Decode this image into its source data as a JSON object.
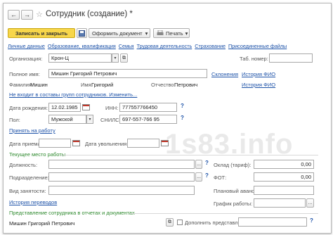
{
  "header": {
    "title": "Сотрудник (создание) *",
    "back_arrow": "←",
    "forward_arrow": "→",
    "star": "☆"
  },
  "toolbar": {
    "save_close": "Записать и закрыть",
    "create_doc": "Оформить документ",
    "print": "Печать",
    "dropdown_arrow": "▾"
  },
  "tabs": [
    "Личные данные",
    "Образование, квалификация",
    "Семья",
    "Трудовая деятельность",
    "Страхование",
    "Присоединенные файлы"
  ],
  "form": {
    "org_label": "Организация:",
    "org_value": "Крон-Ц",
    "tab_num_label": "Таб. номер:",
    "fullname_label": "Полное имя:",
    "fullname_value": "Мишин Григорий Петрович",
    "declension_link": "Склонения",
    "fio_history_link": "История ФИО",
    "surname_label": "Фамилия:",
    "surname_value": "Мишин",
    "name_label": "Имя:",
    "name_value": "Григорий",
    "patronymic_label": "Отчество:",
    "patronymic_value": "Петрович",
    "groups_link": "Не входит в составы групп сотрудников. Изменить...",
    "birth_label": "Дата рождения:",
    "birth_value": "12.02.1985",
    "inn_label": "ИНН:",
    "inn_value": "777557766450",
    "help": "?",
    "sex_label": "Пол:",
    "sex_value": "Мужской",
    "snils_label": "СНИЛС:",
    "snils_value": "697-557-766 95",
    "hire_link": "Принять на работу",
    "hire_date_label": "Дата приема:",
    "dismiss_date_label": "Дата увольнения:"
  },
  "work": {
    "section": "Текущее место работы",
    "position_label": "Должность:",
    "salary_label": "Оклад (тариф):",
    "salary_value": "0,00",
    "dept_label": "Подразделение:",
    "fot_label": "ФОТ:",
    "fot_value": "0,00",
    "emp_type_label": "Вид занятости:",
    "advance_label": "Плановый аванс:",
    "transfers_link": "История переводов",
    "schedule_label": "График работы:",
    "ellipsis": "...",
    "copy_icon": "⧉"
  },
  "repr": {
    "section": "Представление сотрудника в отчетах и документах",
    "value": "Мишин Григорий Петрович",
    "extra_label": "Дополнить представление"
  },
  "watermark": "1s83.info"
}
